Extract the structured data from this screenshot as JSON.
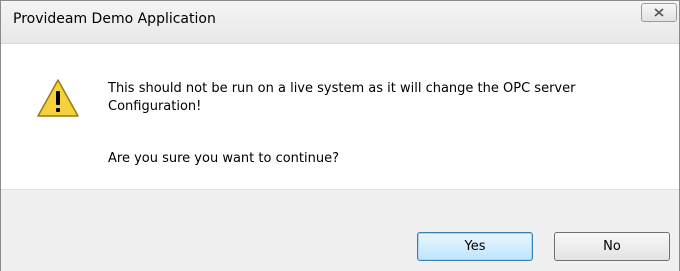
{
  "window": {
    "title": "Provideam Demo Application",
    "close_icon": "close-icon"
  },
  "dialog": {
    "icon": "warning-icon",
    "message": "This should not be run on a live system as it will change the OPC server Configuration!",
    "question": "Are you sure you want to continue?"
  },
  "buttons": {
    "yes_label": "Yes",
    "no_label": "No"
  },
  "colors": {
    "footer_bg": "#f0f0f0",
    "default_button_border": "#3c7fb1",
    "warning_yellow": "#f4d23c"
  }
}
